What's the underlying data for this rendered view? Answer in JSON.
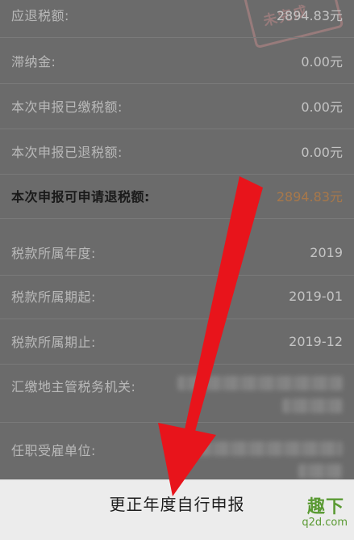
{
  "stamp": {
    "text": "未完成"
  },
  "rows": [
    {
      "label": "应退税额:",
      "value": "2894.83元"
    },
    {
      "label": "滞纳金:",
      "value": "0.00元"
    },
    {
      "label": "本次申报已缴税额:",
      "value": "0.00元"
    },
    {
      "label": "本次申报已退税额:",
      "value": "0.00元"
    },
    {
      "label": "本次申报可申请退税额:",
      "value": "2894.83元"
    },
    {
      "label": "税款所属年度:",
      "value": "2019"
    },
    {
      "label": "税款所属期起:",
      "value": "2019-01"
    },
    {
      "label": "税款所属期止:",
      "value": "2019-12"
    },
    {
      "label": "汇缴地主管税务机关:",
      "value": ""
    },
    {
      "label": "任职受雇单位:",
      "value": ""
    }
  ],
  "bottom_button": {
    "label": "更正年度自行申报"
  },
  "watermark": {
    "line1": "趣下",
    "line2": "q2d.com"
  },
  "colors": {
    "arrow": "#e8141b",
    "refund_value": "#a8784a"
  }
}
